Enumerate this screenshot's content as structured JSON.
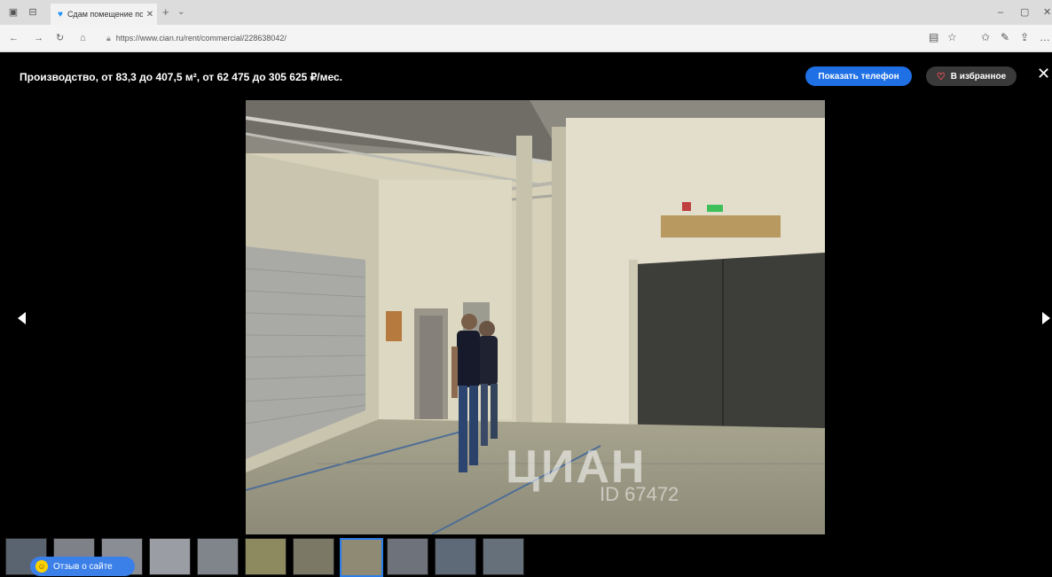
{
  "browser": {
    "tab_title": "Сдам помещение под",
    "url": "https://www.cian.ru/rent/commercial/228638042/"
  },
  "viewer": {
    "title": "Производство, от 83,3 до 407,5 м², от 62 475 до 305 625 ₽/мес.",
    "show_phone_label": "Показать телефон",
    "favorite_label": "В избранное",
    "watermark_logo": "ЦИАН",
    "watermark_id": "ID 67472",
    "feedback_label": "Отзыв о сайте",
    "thumbnails_count": 11,
    "active_thumbnail_index": 7
  },
  "colors": {
    "accent_blue": "#1f6fe5",
    "favorite_heart": "#ff4f5a"
  }
}
